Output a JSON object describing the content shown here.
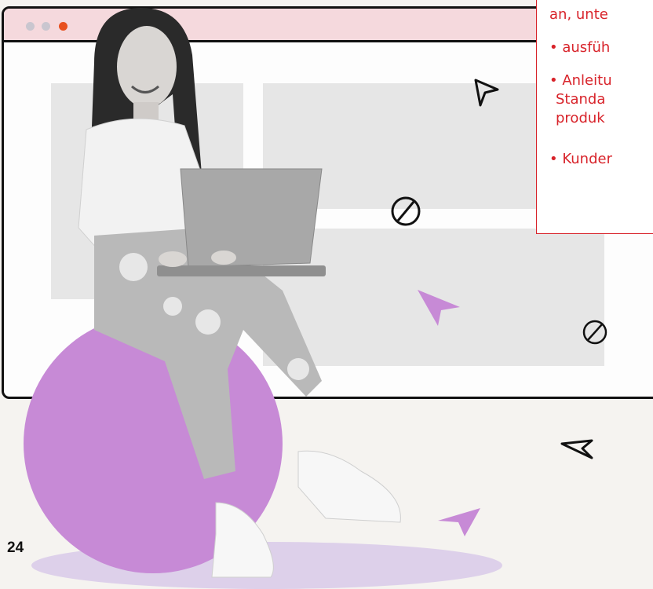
{
  "callout": {
    "lines": [
      "an, unte",
      "• ausfüh",
      "• Anleitu",
      "Standa",
      "produk",
      "• Kunder"
    ]
  },
  "page_number": "24",
  "colors": {
    "accent_red": "#d8232a",
    "titlebar_pink": "#f5d9dd",
    "purple": "#c78ad6",
    "placeholder_gray": "#e6e6e6"
  },
  "icons": [
    "cursor-icon",
    "blocked-icon",
    "window-dot-icon"
  ]
}
